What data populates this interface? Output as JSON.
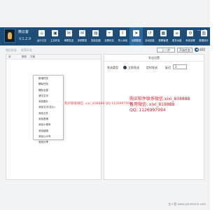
{
  "header": {
    "app_title": "微云客",
    "version": "V.1.2.9",
    "nav": [
      {
        "label": "运行日志",
        "icon": "home-icon",
        "glyph": "⌂"
      },
      {
        "label": "主页好友",
        "icon": "contacts-icon",
        "glyph": "▣"
      },
      {
        "label": "单群发送",
        "icon": "message-icon",
        "glyph": "✉"
      },
      {
        "label": "多群群发",
        "icon": "group-send-icon",
        "glyph": "✉"
      },
      {
        "label": "发朋友圈",
        "icon": "moments-icon",
        "glyph": "▤"
      },
      {
        "label": "加群好友",
        "icon": "add-group-icon",
        "glyph": "+"
      },
      {
        "label": "导入添加",
        "icon": "import-icon",
        "glyph": "⇩"
      },
      {
        "label": "加载数据",
        "icon": "send-icon",
        "glyph": "➤"
      },
      {
        "label": "自动回复",
        "icon": "auto-reply-icon",
        "glyph": "↺"
      },
      {
        "label": "群聊管理",
        "icon": "chat-manage-icon",
        "glyph": "▦"
      },
      {
        "label": "更多功能",
        "icon": "more-icon",
        "glyph": "≡"
      },
      {
        "label": "系统设置",
        "icon": "settings-icon",
        "glyph": "⚙"
      },
      {
        "label": "数据统计",
        "icon": "stats-icon",
        "glyph": "▥"
      }
    ],
    "window_controls": {
      "minimize": "—",
      "close": "✕"
    }
  },
  "toolbar": {
    "subtabs": [
      "微信好友",
      "标签好友"
    ],
    "prev_label": "上一步",
    "next_label": "开始任务",
    "back_label": "返回"
  },
  "left_panel": {
    "columns": [
      "序",
      "微信",
      "方案"
    ],
    "context_menu": [
      "新增任务",
      "删除任务",
      "删除全部",
      "清空文字",
      "添加图片",
      "添加文字(名片)",
      "添加文件",
      "添加表情",
      "添加小程序",
      "添加链接",
      "添加公众号",
      "添加分享"
    ]
  },
  "right_panel": {
    "title": "发送设置",
    "type_label": "发送类型",
    "option_now": "立即发送",
    "option_scheduled": "定时发送",
    "interval_label": "延迟",
    "interval_value": "2"
  },
  "overlay": {
    "watermark_left": "购买联系微信: xixi_838888   QQ:1126997994",
    "watermark_right": [
      "购买软件联系微信:xixi_838888",
      "备用微信: xixi_818888",
      "QQ: 1126997994"
    ]
  },
  "footer": {
    "site": "言人营 www.yanrenxin.com"
  },
  "colors": {
    "header": "#1e4d78",
    "overlay_red": "#e11d2a"
  }
}
